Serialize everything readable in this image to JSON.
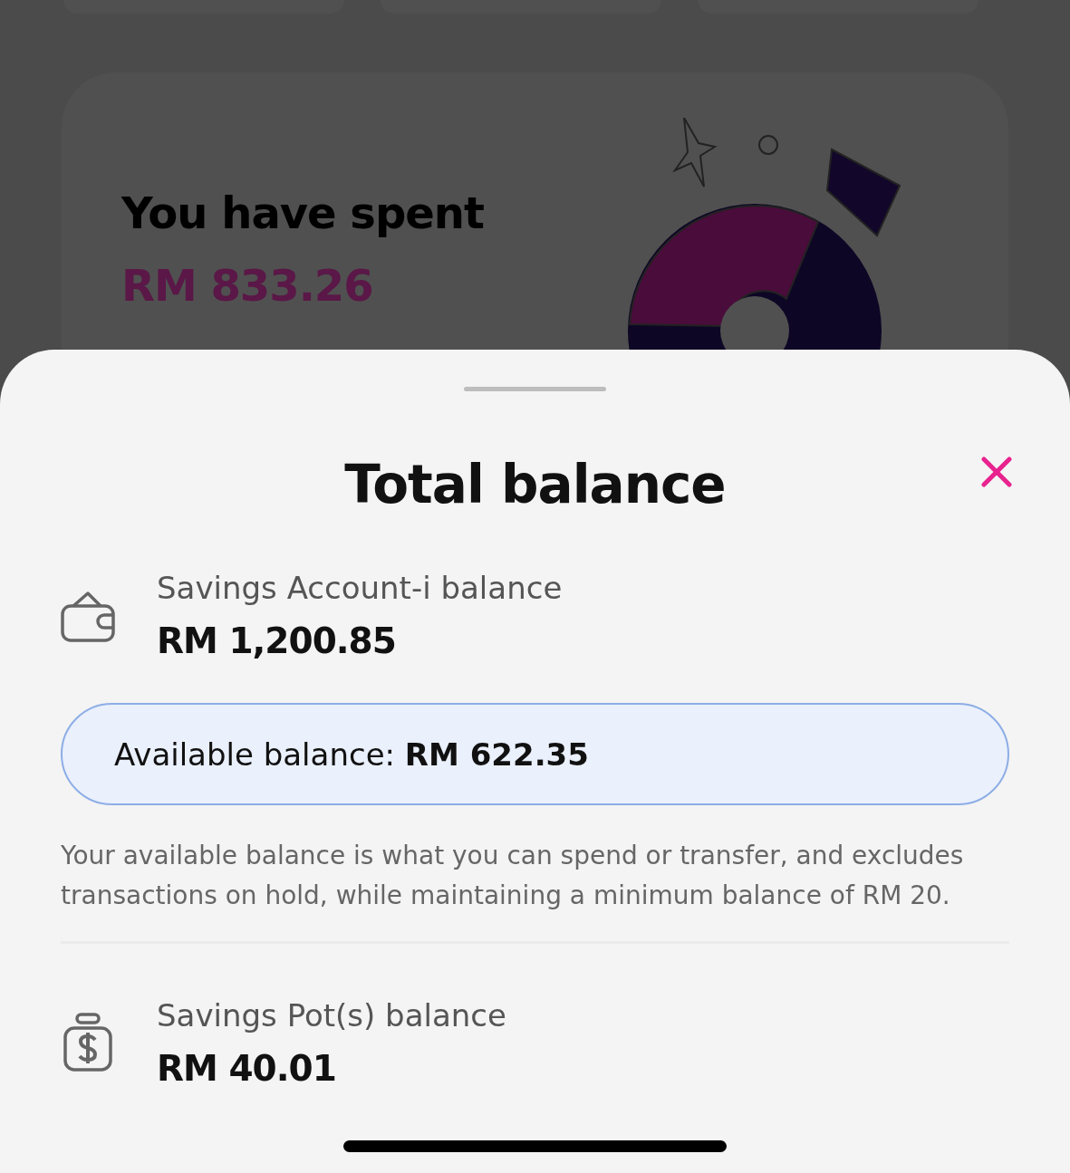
{
  "background": {
    "summary_card": {
      "heading": "You have spent",
      "amount": "RM 833.26"
    }
  },
  "sheet": {
    "title": "Total balance",
    "sections": [
      {
        "kind": "wallet",
        "label": "Savings Account-i balance",
        "amount": "RM 1,200.85"
      },
      {
        "kind": "available",
        "text": "Available balance: **RM 622.35**"
      },
      {
        "kind": "note",
        "text": "Your available balance is what you can spend or transfer, and excludes transactions on hold, while maintaining a minimum balance of RM 20."
      },
      {
        "kind": "divider"
      },
      {
        "kind": "pot",
        "label": "Savings Pot(s) balance",
        "amount": "RM 40.01"
      }
    ]
  }
}
